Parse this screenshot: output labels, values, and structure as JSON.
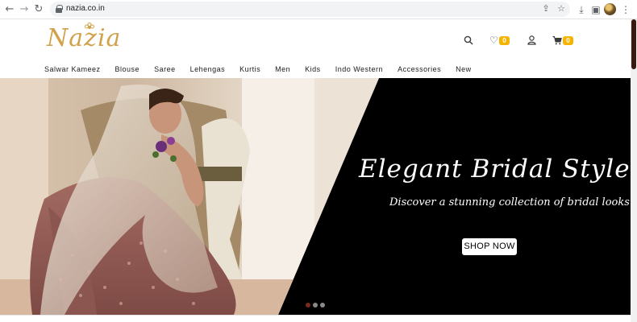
{
  "browser": {
    "url": "nazia.co.in",
    "icons": [
      "back-arrow-icon",
      "forward-arrow-icon",
      "reload-icon",
      "lock-icon",
      "share-icon",
      "star-icon",
      "download-icon",
      "sidepanel-icon",
      "profile-avatar",
      "more-vert-icon"
    ]
  },
  "header": {
    "logo_text": "Nazia",
    "wishlist_count": "0",
    "cart_count": "0",
    "colors": {
      "logo_gold": "#d1a24a",
      "badge": "#f4b400"
    }
  },
  "menu": {
    "items": [
      "Salwar Kameez",
      "Blouse",
      "Saree",
      "Lehengas",
      "Kurtis",
      "Men",
      "Kids",
      "Indo Western",
      "Accessories",
      "New"
    ]
  },
  "hero": {
    "title": "Elegant Bridal Styles",
    "subtitle": "Discover a stunning collection of bridal looks",
    "button_label": "SHOP NOW",
    "slides": 3,
    "active_slide": 1,
    "colors": {
      "panel": "#000000",
      "dot_active": "#7a2a1a",
      "dot": "#8a8a8a"
    }
  }
}
